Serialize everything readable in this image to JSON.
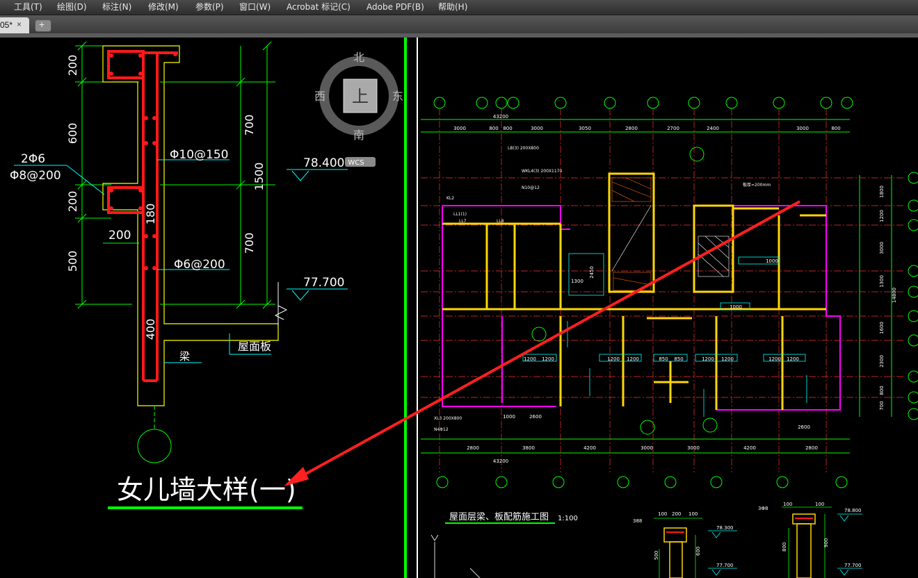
{
  "menu": [
    {
      "id": "tools",
      "label": "工具(T)"
    },
    {
      "id": "draw",
      "label": "绘图(D)"
    },
    {
      "id": "dim",
      "label": "标注(N)"
    },
    {
      "id": "modify",
      "label": "修改(M)"
    },
    {
      "id": "params",
      "label": "参数(P)"
    },
    {
      "id": "window",
      "label": "窗口(W)"
    },
    {
      "id": "acrobat",
      "label": "Acrobat 标记(C)"
    },
    {
      "id": "pdf",
      "label": "Adobe PDF(B)"
    },
    {
      "id": "help",
      "label": "帮助(H)"
    }
  ],
  "tab": {
    "label": "05*",
    "close": "×",
    "new": "+"
  },
  "viewcube": {
    "north": "北",
    "south": "南",
    "east": "东",
    "west": "西",
    "face": "上",
    "wcs": "WCS"
  },
  "detail": {
    "dims_left": [
      "200",
      "600",
      "200",
      "500"
    ],
    "dims_mid": [
      "700",
      "1500",
      "700"
    ],
    "rebar1": "2Φ6",
    "rebar2": "Φ8@200",
    "rebar3": "Φ10@150",
    "rebar4": "Φ6@200",
    "dim180": "180",
    "dim200": "200",
    "dim400": "400",
    "elev1": "78.400",
    "elev2": "77.700",
    "roofslab": "屋面板",
    "beam": "梁",
    "title": "女儿墙大样(一)"
  },
  "plan": {
    "top_dims": [
      "3000",
      "800",
      "800",
      "3000",
      "3050",
      "2800",
      "2700",
      "2400",
      "3000",
      "800"
    ],
    "total_top": "43200",
    "bottom_dims": [
      "2800",
      "3800",
      "4200",
      "3000",
      "3000",
      "4200",
      "2800"
    ],
    "total_bottom": "43200",
    "right_dims": [
      "1800",
      "1200",
      "3000",
      "1300",
      "1600",
      "2300",
      "800",
      "700"
    ],
    "right_total": "14800",
    "inner_dims": [
      "1000",
      "1000",
      "1200",
      "1200",
      "1200",
      "1200",
      "850",
      "850",
      "1200",
      "1200",
      "1200",
      "1200",
      "1000",
      "2600",
      "2600",
      "1300",
      "2450"
    ],
    "title": "屋面层梁、板配筋施工图",
    "scale": "1:100",
    "beam_labels": [
      "LB(3) 200X800",
      "LL1(1)",
      "LL7",
      "LL8",
      "KL2",
      "WKL4(3) 200X1170",
      "N10@12",
      "N4Φ12",
      "XL3 200X800"
    ],
    "note": "板厚=200mm",
    "small_elev": [
      "78.300",
      "77.700",
      "78.800",
      "77.700"
    ],
    "small_dims": [
      "100",
      "200",
      "100",
      "500",
      "600",
      "100",
      "100",
      "800",
      "900",
      "388",
      "3Φ8"
    ]
  }
}
